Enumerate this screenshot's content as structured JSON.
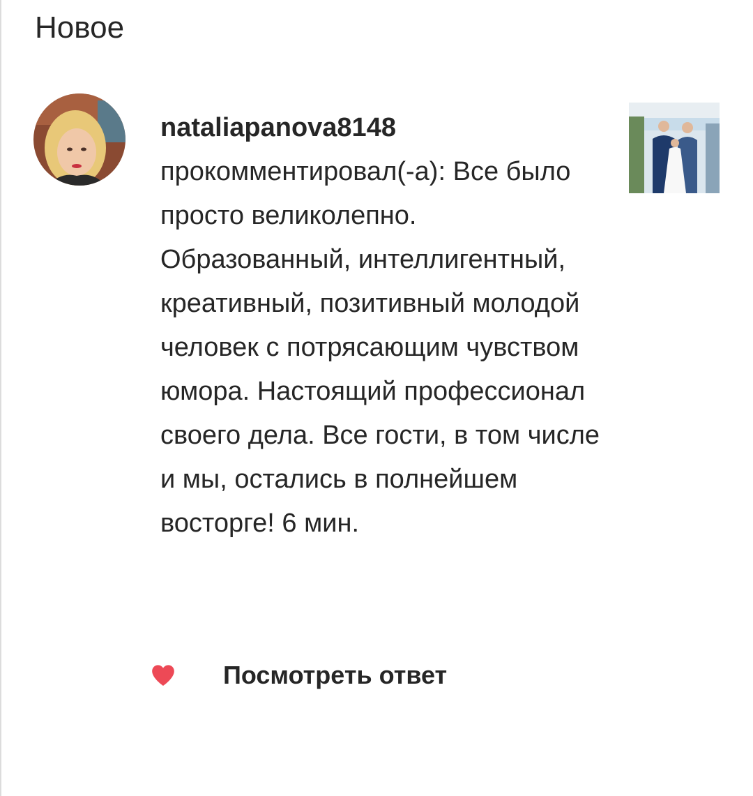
{
  "header": {
    "title": "Новое"
  },
  "notification": {
    "avatar_icon": "user-avatar-photo",
    "username": "nataliapanova8148",
    "action_text": "прокомментировал(-а):",
    "comment_text": "Все было просто великолепно. Образованный, интеллигентный, креативный, позитивный молодой человек с потрясающим чувством юмора. Настоящий профессионал своего дела. Все гости, в том числе и мы, остались в полнейшем восторге!",
    "timestamp": "6 мин.",
    "thumbnail_icon": "post-thumbnail-photo"
  },
  "actions": {
    "like_icon": "heart-icon",
    "like_color": "#ed4956",
    "view_reply_label": "Посмотреть ответ"
  }
}
